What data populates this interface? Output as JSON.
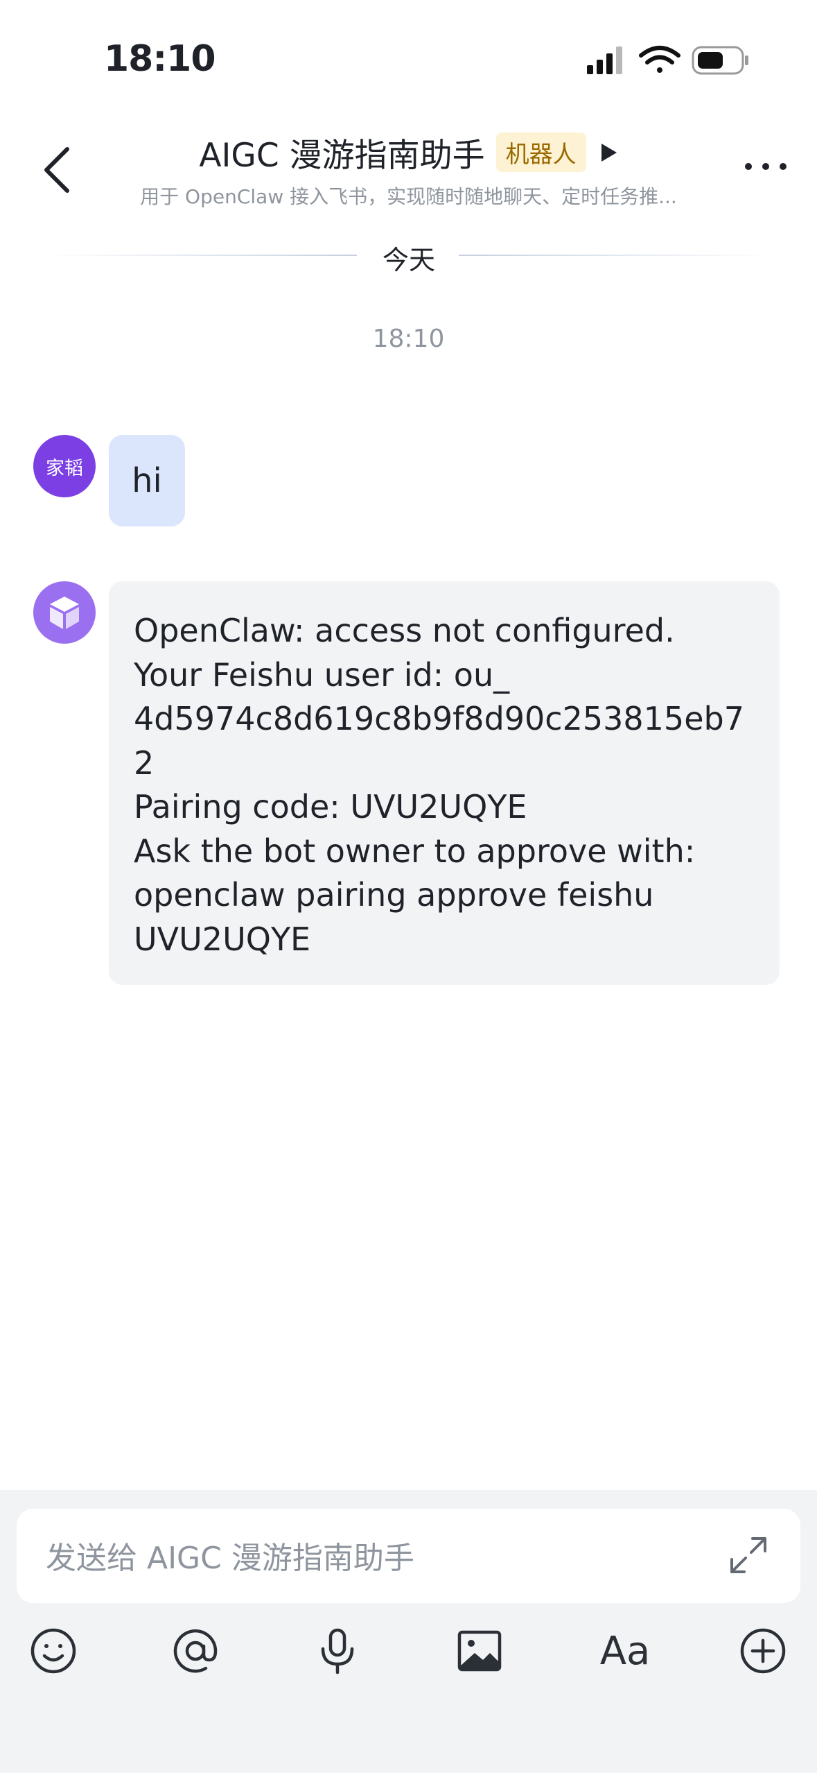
{
  "status_bar": {
    "time": "18:10"
  },
  "header": {
    "title": "AIGC 漫游指南助手",
    "badge": "机器人",
    "subtitle": "用于 OpenClaw 接入飞书，实现随时随地聊天、定时任务推..."
  },
  "chat": {
    "date_divider": "今天",
    "timestamp": "18:10",
    "messages": [
      {
        "sender_avatar": "家韬",
        "text": "hi"
      },
      {
        "sender_avatar": "bot-cube-icon",
        "lines": [
          "OpenClaw: access not configured.",
          "Your Feishu user id: ou_",
          "4d5974c8d619c8b9f8d90c253815eb7",
          "2",
          "Pairing code: UVU2UQYE",
          "Ask the bot owner to approve with:",
          "openclaw pairing approve feishu",
          "UVU2UQYE"
        ]
      }
    ]
  },
  "composer": {
    "placeholder": "发送给 AIGC 漫游指南助手",
    "format_label": "Aa"
  }
}
